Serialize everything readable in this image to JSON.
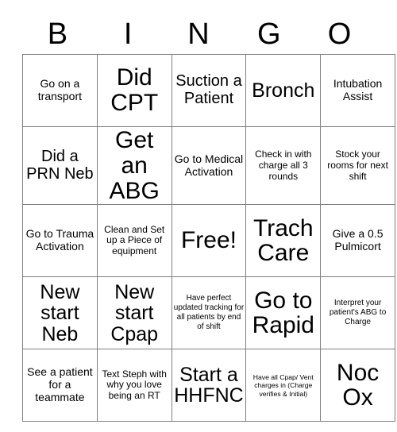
{
  "card": {
    "header_letters": [
      "B",
      "I",
      "N",
      "G",
      "O"
    ],
    "columns": 5,
    "rows": 5,
    "free_space_index": 12,
    "grid_line_color": "#7f7f7f",
    "text_color": "#000000",
    "background_color": "#ffffff",
    "cells": [
      {
        "text": "Go on a transport",
        "size": "fs-md"
      },
      {
        "text": "Did CPT",
        "size": "fs-xxl"
      },
      {
        "text": "Suction a Patient",
        "size": "fs-lg"
      },
      {
        "text": "Bronch",
        "size": "fs-xl"
      },
      {
        "text": "Intubation Assist",
        "size": "fs-md"
      },
      {
        "text": "Did a PRN Neb",
        "size": "fs-lg"
      },
      {
        "text": "Get an ABG",
        "size": "fs-xxl"
      },
      {
        "text": "Go to Medical Activation",
        "size": "fs-md"
      },
      {
        "text": "Check in with charge all 3 rounds",
        "size": "fs-sm"
      },
      {
        "text": "Stock your rooms for next shift",
        "size": "fs-sm"
      },
      {
        "text": "Go to Trauma Activation",
        "size": "fs-md"
      },
      {
        "text": "Clean and Set up a Piece of equipment",
        "size": "fs-sm"
      },
      {
        "text": "Free!",
        "size": "fs-xxl"
      },
      {
        "text": "Trach Care",
        "size": "fs-xxl"
      },
      {
        "text": "Give a 0.5 Pulmicort",
        "size": "fs-md"
      },
      {
        "text": "New start Neb",
        "size": "fs-xl"
      },
      {
        "text": "New start Cpap",
        "size": "fs-xl"
      },
      {
        "text": "Have perfect updated tracking for all patients by end of shift",
        "size": "fs-xs"
      },
      {
        "text": "Go to Rapid",
        "size": "fs-xxl"
      },
      {
        "text": "Interpret your patient's ABG to Charge",
        "size": "fs-xs"
      },
      {
        "text": "See a patient for a teammate",
        "size": "fs-md"
      },
      {
        "text": "Text Steph with why you love being an RT",
        "size": "fs-sm"
      },
      {
        "text": "Start a HHFNC",
        "size": "fs-xl"
      },
      {
        "text": "Have all Cpap/ Vent charges in (Charge verifies & Initial)",
        "size": "fs-xxs"
      },
      {
        "text": "Noc Ox",
        "size": "fs-xxl"
      }
    ]
  }
}
